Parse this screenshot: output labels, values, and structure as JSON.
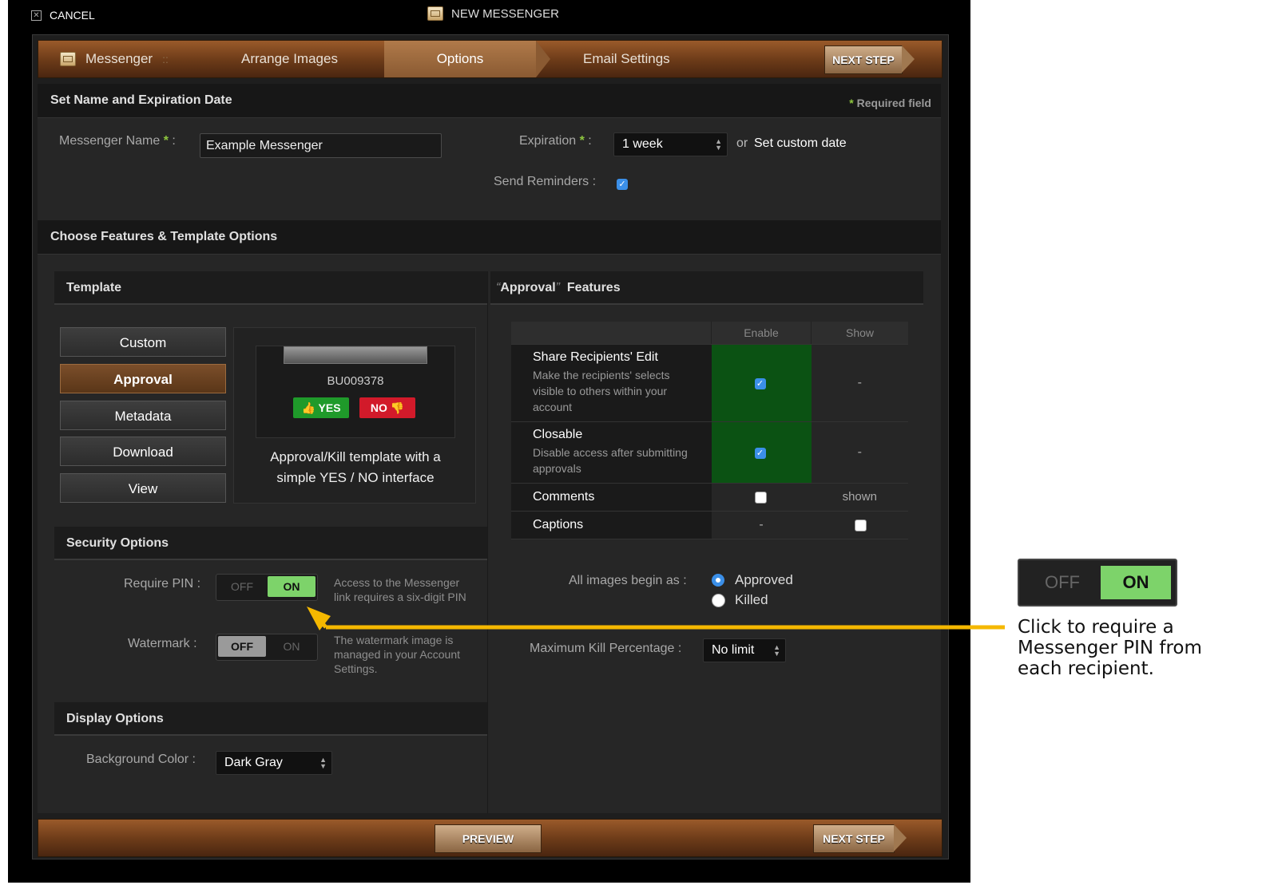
{
  "window": {
    "cancel_label": "CANCEL",
    "title": "NEW MESSENGER"
  },
  "wizard": {
    "steps": [
      "Messenger",
      "Arrange Images",
      "Options",
      "Email Settings"
    ],
    "separator": "::",
    "next_label": "NEXT STEP"
  },
  "name_section": {
    "title": "Set Name and Expiration Date",
    "required_note": "Required field",
    "name_label": "Messenger Name",
    "name_value": "Example Messenger",
    "expiration_label": "Expiration",
    "expiration_value": "1 week",
    "or_text": "or",
    "custom_date_link": "Set custom date",
    "reminders_label": "Send Reminders :",
    "reminders_checked": true
  },
  "features_section": {
    "title": "Choose Features & Template Options"
  },
  "template": {
    "title": "Template",
    "buttons": [
      "Custom",
      "Approval",
      "Metadata",
      "Download",
      "View"
    ],
    "selected": "Approval",
    "preview_id": "BU009378",
    "yes_label": "YES",
    "no_label": "NO",
    "description_line1": "Approval/Kill template with a",
    "description_line2": "simple YES / NO interface"
  },
  "security": {
    "title": "Security Options",
    "pin_label": "Require PIN :",
    "pin_off": "OFF",
    "pin_on": "ON",
    "pin_state": "ON",
    "pin_note_1": "Access to the Messenger",
    "pin_note_2": "link requires a six-digit PIN",
    "watermark_label": "Watermark :",
    "wm_off": "OFF",
    "wm_on": "ON",
    "wm_state": "OFF",
    "wm_note_1": "The watermark image is",
    "wm_note_2": "managed in your Account",
    "wm_note_3": "Settings."
  },
  "display": {
    "title": "Display Options",
    "bg_label": "Background Color :",
    "bg_value": "Dark Gray"
  },
  "approval_features": {
    "title_quote_open": "“",
    "title_word": "Approval",
    "title_quote_close": "”",
    "title_rest": "Features",
    "col_enable": "Enable",
    "col_show": "Show",
    "rows": [
      {
        "name": "Share Recipients' Edit",
        "desc1": "Make the recipients' selects",
        "desc2": "visible to others within your",
        "desc3": "account",
        "enable": "checked",
        "show": "-"
      },
      {
        "name": "Closable",
        "desc1": "Disable access after submitting",
        "desc2": "approvals",
        "enable": "checked",
        "show": "-"
      },
      {
        "name": "Comments",
        "enable": "unchecked",
        "show": "shown"
      },
      {
        "name": "Captions",
        "enable": "-",
        "show": "unchecked"
      }
    ],
    "begin_label": "All images begin as :",
    "begin_options": [
      "Approved",
      "Killed"
    ],
    "begin_selected": "Approved",
    "max_kill_label": "Maximum Kill Percentage :",
    "max_kill_value": "No limit"
  },
  "footer": {
    "preview_label": "PREVIEW",
    "next_label": "NEXT STEP"
  },
  "callout": {
    "off": "OFF",
    "on": "ON",
    "line1": "Click to require a",
    "line2": "Messenger PIN from",
    "line3": "each recipient.",
    "arrow_color": "#f5b800"
  }
}
